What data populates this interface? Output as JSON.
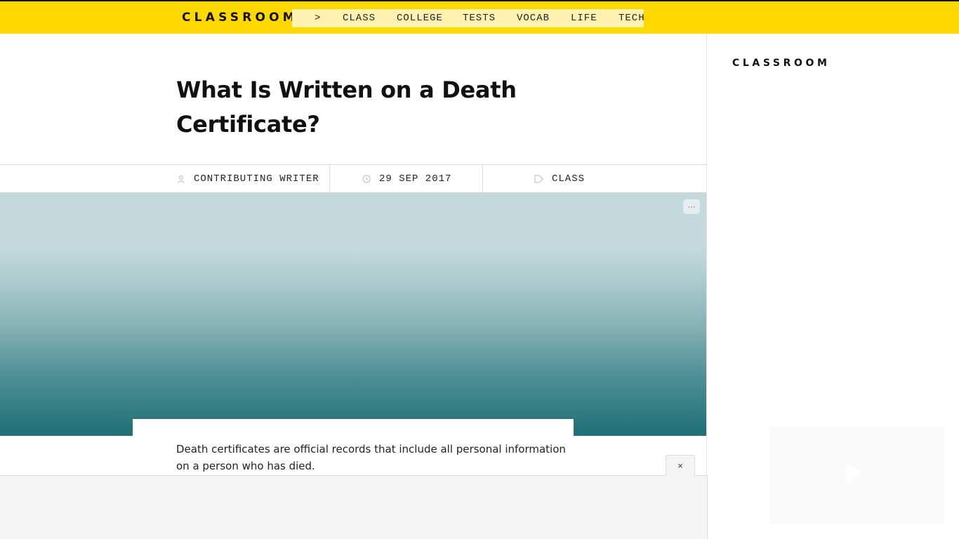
{
  "header": {
    "logo": "CLASSROOM",
    "nav": [
      {
        "label": ">"
      },
      {
        "label": "CLASS"
      },
      {
        "label": "COLLEGE"
      },
      {
        "label": "TESTS"
      },
      {
        "label": "VOCAB"
      },
      {
        "label": "LIFE"
      },
      {
        "label": "TECH"
      }
    ],
    "colors": {
      "bar": "#ffd800",
      "nav_bg": "#fff2b0"
    }
  },
  "article": {
    "title": "What Is Written on a Death Certificate?",
    "meta": {
      "author": "CONTRIBUTING WRITER",
      "date": "29 SEP 2017",
      "category": "CLASS"
    },
    "hero": {
      "more_label": "···",
      "colors": {
        "top": "#c4d9dc",
        "bottom": "#1e6f76"
      }
    },
    "intro": "Death certificates are official records that include all personal information on a person who has died."
  },
  "sidebar": {
    "logo": "CLASSROOM"
  },
  "ad": {
    "close_label": "×"
  }
}
